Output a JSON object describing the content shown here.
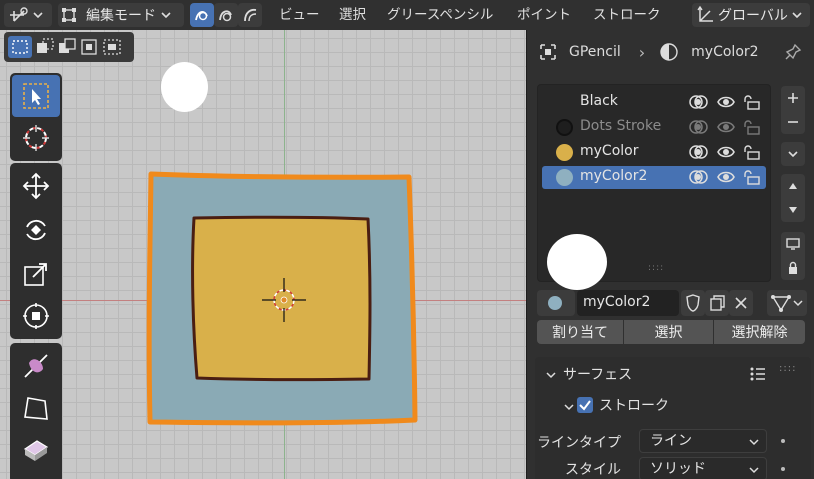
{
  "header": {
    "mode_label": "編集モード",
    "menu": [
      "ビュー",
      "選択",
      "グリースペンシル",
      "ポイント",
      "ストローク"
    ],
    "orientation_label": "グローバル"
  },
  "panel": {
    "breadcrumb_object": "GPencil",
    "breadcrumb_material": "myColor2",
    "slots": [
      {
        "name": "Black",
        "color": null,
        "dim": false,
        "active": false
      },
      {
        "name": "Dots Stroke",
        "color": "#1e1e1e",
        "dim": true,
        "active": false
      },
      {
        "name": "myColor",
        "color": "#d9b04a",
        "dim": false,
        "active": false
      },
      {
        "name": "myColor2",
        "color": "#8fb0c0",
        "dim": false,
        "active": true
      }
    ],
    "material_name": "myColor2",
    "assign_label": "割り当て",
    "select_label": "選択",
    "deselect_label": "選択解除",
    "section_surface": "サーフェス",
    "stroke_label": "ストローク",
    "line_type_label": "ラインタイプ",
    "line_type_value": "ライン",
    "style_label": "スタイル",
    "style_value": "ソリッド"
  },
  "colors": {
    "accent": "#4772b3",
    "outer_fill": "#8aaab5",
    "outer_stroke": "#f08a1c",
    "inner_fill": "#d9b04a",
    "inner_stroke": "#4a1e12"
  }
}
